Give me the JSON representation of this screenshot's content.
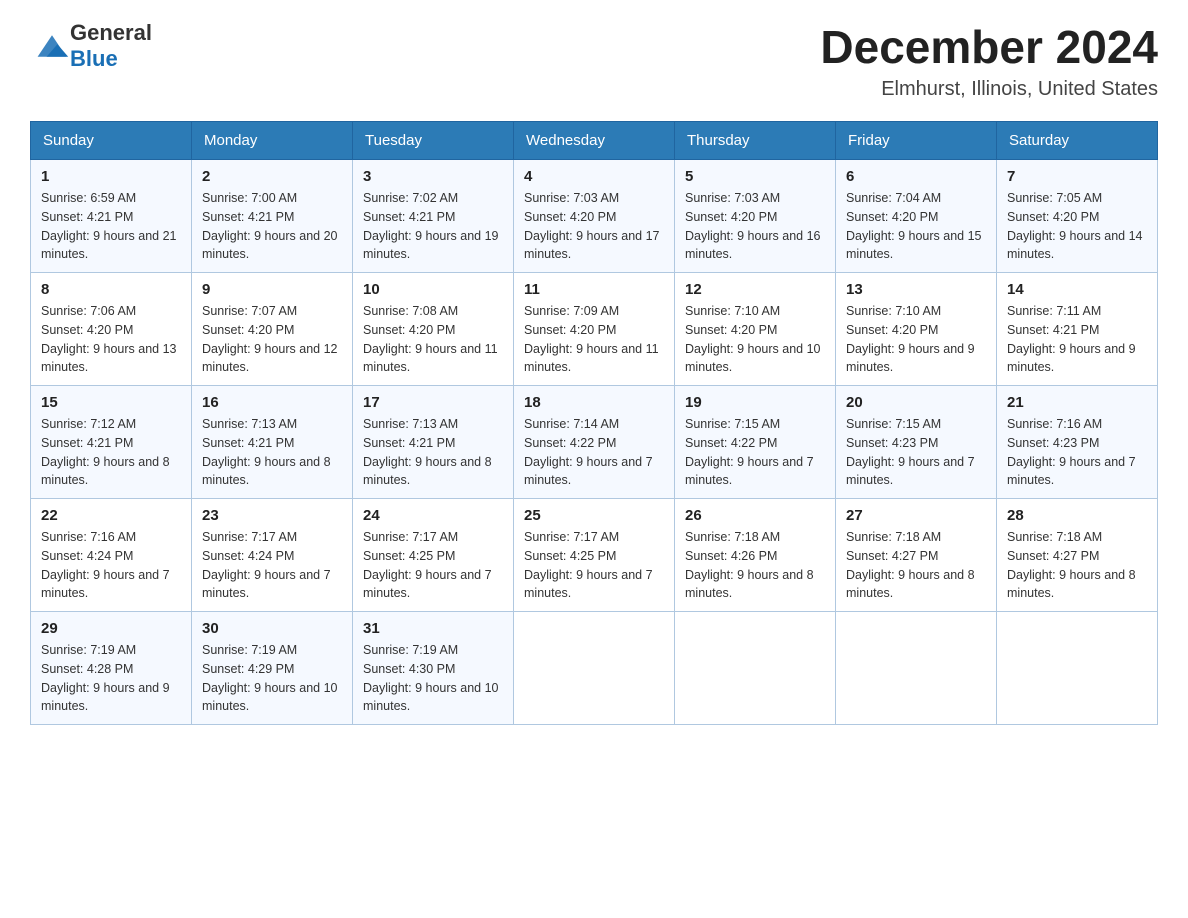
{
  "header": {
    "logo_text_general": "General",
    "logo_text_blue": "Blue",
    "month_year": "December 2024",
    "location": "Elmhurst, Illinois, United States"
  },
  "weekdays": [
    "Sunday",
    "Monday",
    "Tuesday",
    "Wednesday",
    "Thursday",
    "Friday",
    "Saturday"
  ],
  "weeks": [
    [
      {
        "day": "1",
        "sunrise": "6:59 AM",
        "sunset": "4:21 PM",
        "daylight": "9 hours and 21 minutes."
      },
      {
        "day": "2",
        "sunrise": "7:00 AM",
        "sunset": "4:21 PM",
        "daylight": "9 hours and 20 minutes."
      },
      {
        "day": "3",
        "sunrise": "7:02 AM",
        "sunset": "4:21 PM",
        "daylight": "9 hours and 19 minutes."
      },
      {
        "day": "4",
        "sunrise": "7:03 AM",
        "sunset": "4:20 PM",
        "daylight": "9 hours and 17 minutes."
      },
      {
        "day": "5",
        "sunrise": "7:03 AM",
        "sunset": "4:20 PM",
        "daylight": "9 hours and 16 minutes."
      },
      {
        "day": "6",
        "sunrise": "7:04 AM",
        "sunset": "4:20 PM",
        "daylight": "9 hours and 15 minutes."
      },
      {
        "day": "7",
        "sunrise": "7:05 AM",
        "sunset": "4:20 PM",
        "daylight": "9 hours and 14 minutes."
      }
    ],
    [
      {
        "day": "8",
        "sunrise": "7:06 AM",
        "sunset": "4:20 PM",
        "daylight": "9 hours and 13 minutes."
      },
      {
        "day": "9",
        "sunrise": "7:07 AM",
        "sunset": "4:20 PM",
        "daylight": "9 hours and 12 minutes."
      },
      {
        "day": "10",
        "sunrise": "7:08 AM",
        "sunset": "4:20 PM",
        "daylight": "9 hours and 11 minutes."
      },
      {
        "day": "11",
        "sunrise": "7:09 AM",
        "sunset": "4:20 PM",
        "daylight": "9 hours and 11 minutes."
      },
      {
        "day": "12",
        "sunrise": "7:10 AM",
        "sunset": "4:20 PM",
        "daylight": "9 hours and 10 minutes."
      },
      {
        "day": "13",
        "sunrise": "7:10 AM",
        "sunset": "4:20 PM",
        "daylight": "9 hours and 9 minutes."
      },
      {
        "day": "14",
        "sunrise": "7:11 AM",
        "sunset": "4:21 PM",
        "daylight": "9 hours and 9 minutes."
      }
    ],
    [
      {
        "day": "15",
        "sunrise": "7:12 AM",
        "sunset": "4:21 PM",
        "daylight": "9 hours and 8 minutes."
      },
      {
        "day": "16",
        "sunrise": "7:13 AM",
        "sunset": "4:21 PM",
        "daylight": "9 hours and 8 minutes."
      },
      {
        "day": "17",
        "sunrise": "7:13 AM",
        "sunset": "4:21 PM",
        "daylight": "9 hours and 8 minutes."
      },
      {
        "day": "18",
        "sunrise": "7:14 AM",
        "sunset": "4:22 PM",
        "daylight": "9 hours and 7 minutes."
      },
      {
        "day": "19",
        "sunrise": "7:15 AM",
        "sunset": "4:22 PM",
        "daylight": "9 hours and 7 minutes."
      },
      {
        "day": "20",
        "sunrise": "7:15 AM",
        "sunset": "4:23 PM",
        "daylight": "9 hours and 7 minutes."
      },
      {
        "day": "21",
        "sunrise": "7:16 AM",
        "sunset": "4:23 PM",
        "daylight": "9 hours and 7 minutes."
      }
    ],
    [
      {
        "day": "22",
        "sunrise": "7:16 AM",
        "sunset": "4:24 PM",
        "daylight": "9 hours and 7 minutes."
      },
      {
        "day": "23",
        "sunrise": "7:17 AM",
        "sunset": "4:24 PM",
        "daylight": "9 hours and 7 minutes."
      },
      {
        "day": "24",
        "sunrise": "7:17 AM",
        "sunset": "4:25 PM",
        "daylight": "9 hours and 7 minutes."
      },
      {
        "day": "25",
        "sunrise": "7:17 AM",
        "sunset": "4:25 PM",
        "daylight": "9 hours and 7 minutes."
      },
      {
        "day": "26",
        "sunrise": "7:18 AM",
        "sunset": "4:26 PM",
        "daylight": "9 hours and 8 minutes."
      },
      {
        "day": "27",
        "sunrise": "7:18 AM",
        "sunset": "4:27 PM",
        "daylight": "9 hours and 8 minutes."
      },
      {
        "day": "28",
        "sunrise": "7:18 AM",
        "sunset": "4:27 PM",
        "daylight": "9 hours and 8 minutes."
      }
    ],
    [
      {
        "day": "29",
        "sunrise": "7:19 AM",
        "sunset": "4:28 PM",
        "daylight": "9 hours and 9 minutes."
      },
      {
        "day": "30",
        "sunrise": "7:19 AM",
        "sunset": "4:29 PM",
        "daylight": "9 hours and 10 minutes."
      },
      {
        "day": "31",
        "sunrise": "7:19 AM",
        "sunset": "4:30 PM",
        "daylight": "9 hours and 10 minutes."
      },
      null,
      null,
      null,
      null
    ]
  ],
  "labels": {
    "sunrise": "Sunrise:",
    "sunset": "Sunset:",
    "daylight": "Daylight:"
  }
}
